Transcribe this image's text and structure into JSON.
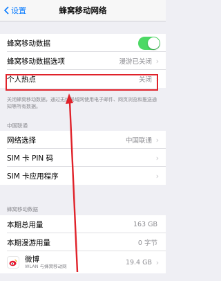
{
  "nav": {
    "back_label": "设置",
    "title": "蜂窝移动网络"
  },
  "cellular": {
    "data_label": "蜂窝移动数据",
    "data_enabled": true,
    "options_label": "蜂窝移动数据选项",
    "options_value": "漫游已关闭",
    "hotspot_label": "个人热点",
    "hotspot_value": "关闭"
  },
  "footnote": "关闭蜂窝移动数据，通过无线局域网使用电子邮件、网页浏览和推送通知等所有数据。",
  "carrier_section": {
    "header": "中国联通",
    "network_label": "网络选择",
    "network_value": "中国联通",
    "pin_label": "SIM 卡 PIN 码",
    "apps_label": "SIM 卡应用程序"
  },
  "usage_section": {
    "header": "蜂窝移动数据",
    "current_label": "本期总用量",
    "current_value": "163 GB",
    "roaming_label": "本期漫游用量",
    "roaming_value": "0 字节",
    "app_name": "微博",
    "app_sub": "WLAN 与蜂窝移动网",
    "app_value": "19.4 GB",
    "app_enabled": true
  },
  "colors": {
    "accent": "#0a7cff",
    "toggle_on": "#4cd964",
    "annotation_red": "#e0222a"
  }
}
